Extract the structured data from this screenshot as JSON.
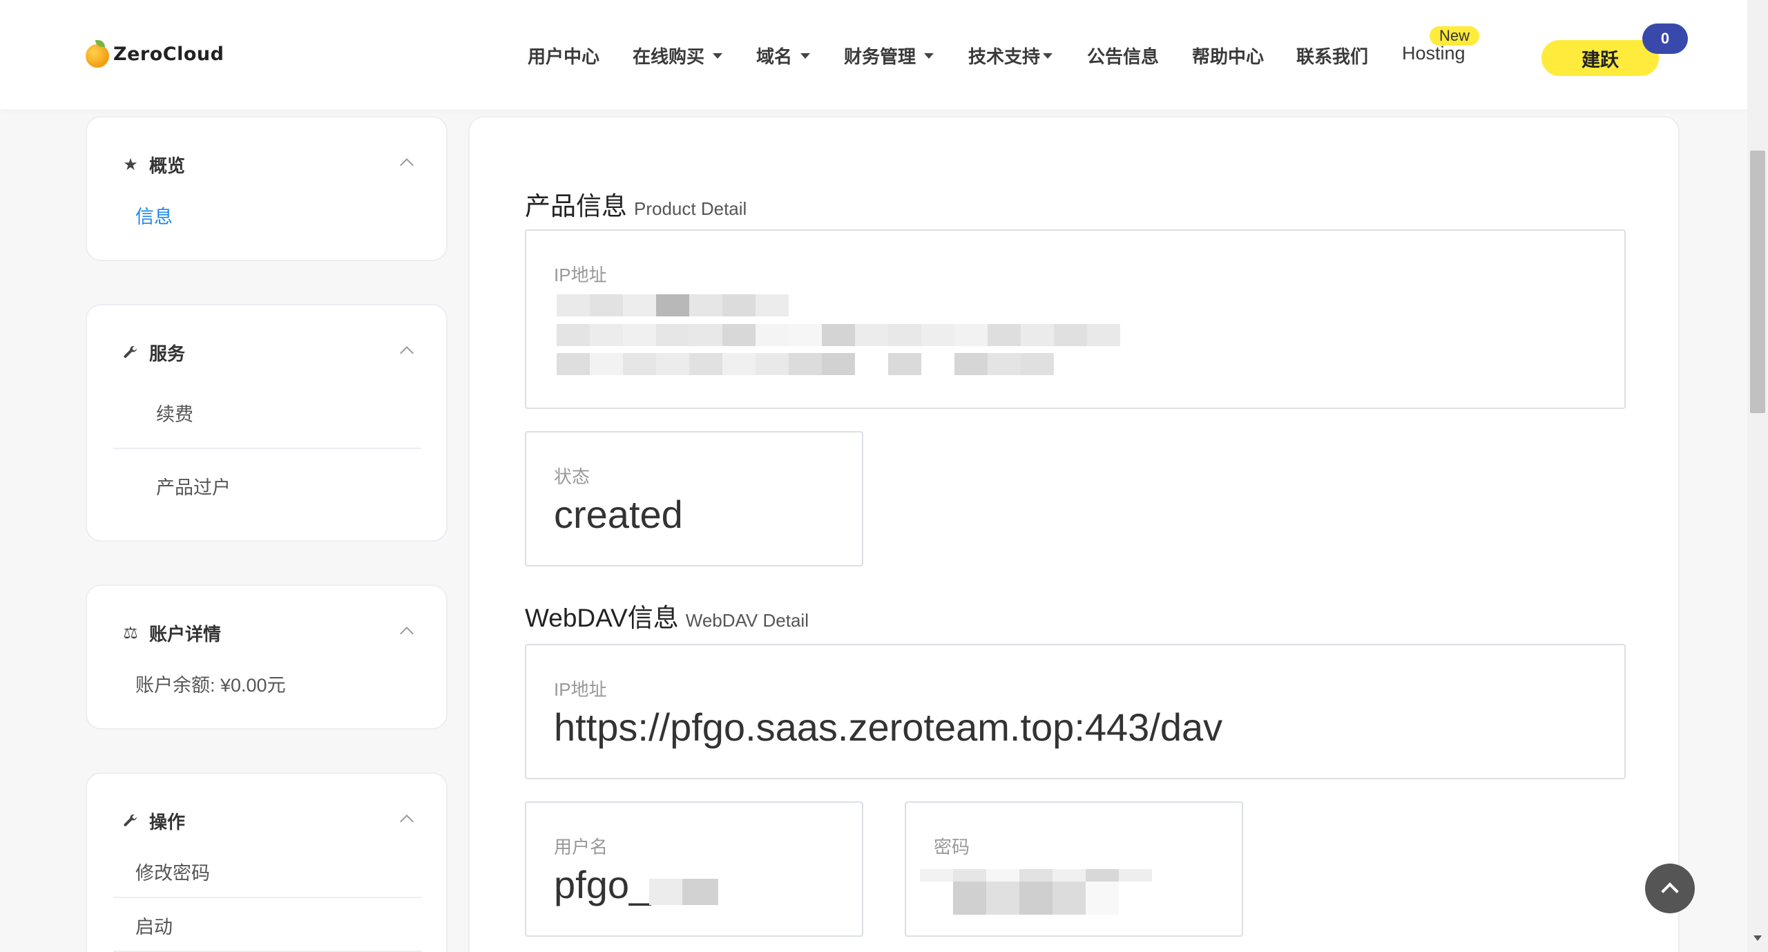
{
  "brand": {
    "name": "ZeroCloud"
  },
  "nav": {
    "items": [
      {
        "label": "用户中心",
        "dropdown": false
      },
      {
        "label": "在线购买",
        "dropdown": true
      },
      {
        "label": "域名",
        "dropdown": true
      },
      {
        "label": "财务管理",
        "dropdown": true
      },
      {
        "label": "技术支持",
        "dropdown": true
      },
      {
        "label": "公告信息",
        "dropdown": false
      },
      {
        "label": "帮助中心",
        "dropdown": false
      },
      {
        "label": "联系我们",
        "dropdown": false
      }
    ],
    "hosting_label": "Hosting",
    "new_badge": "New",
    "user_label": "建跃",
    "cart_count": "0"
  },
  "sidebar": {
    "overview": {
      "title": "概览",
      "links": [
        "信息"
      ]
    },
    "services": {
      "title": "服务",
      "links": [
        "续费",
        "产品过户"
      ]
    },
    "account": {
      "title": "账户详情",
      "balance": "账户余额: ¥0.00元"
    },
    "operations": {
      "title": "操作",
      "links": [
        "修改密码",
        "启动"
      ]
    }
  },
  "main": {
    "product_section": {
      "title": "产品信息",
      "subtitle": "Product Detail"
    },
    "ip_field": {
      "label": "IP地址",
      "value_redacted": true
    },
    "status_field": {
      "label": "状态",
      "value": "created"
    },
    "webdav_section": {
      "title": "WebDAV信息",
      "subtitle": "WebDAV Detail"
    },
    "webdav_ip_field": {
      "label": "IP地址",
      "value": "https://pfgo.saas.zeroteam.top:443/dav"
    },
    "username_field": {
      "label": "用户名",
      "value": "pfgo_"
    },
    "password_field": {
      "label": "密码",
      "value_redacted": true
    }
  },
  "colors": {
    "accent_yellow": "#ffeb3b",
    "badge_blue": "#3949ab",
    "link_blue": "#1e88e5",
    "page_bg": "#f7f7f8"
  }
}
